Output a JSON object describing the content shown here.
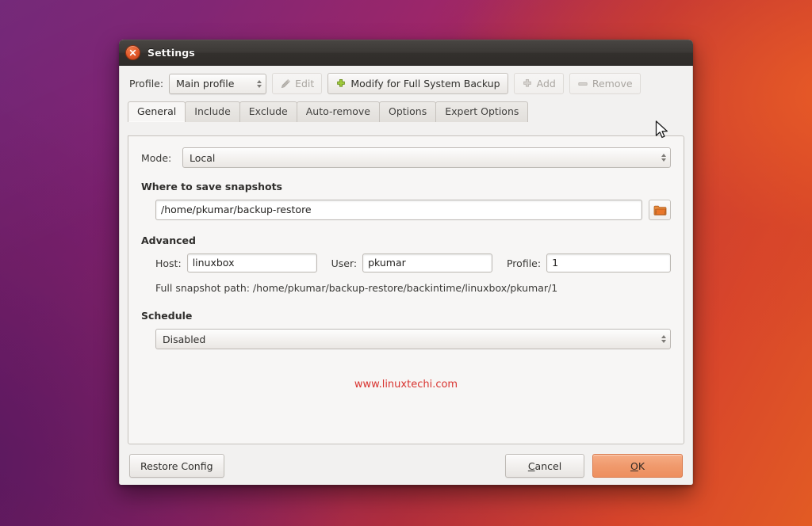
{
  "window": {
    "title": "Settings",
    "close_icon": "close-icon"
  },
  "toolbar": {
    "profile_label": "Profile:",
    "profile_value": "Main profile",
    "edit_label": "Edit",
    "edit_icon": "pencil-icon",
    "modify_label": "Modify for Full System Backup",
    "modify_icon": "plus-icon",
    "add_label": "Add",
    "add_icon": "plus-icon",
    "remove_label": "Remove",
    "remove_icon": "minus-icon"
  },
  "tabs": [
    {
      "label": "General",
      "active": true
    },
    {
      "label": "Include",
      "active": false
    },
    {
      "label": "Exclude",
      "active": false
    },
    {
      "label": "Auto-remove",
      "active": false
    },
    {
      "label": "Options",
      "active": false
    },
    {
      "label": "Expert Options",
      "active": false
    }
  ],
  "general": {
    "mode_label": "Mode:",
    "mode_value": "Local",
    "snapshots_heading": "Where to save snapshots",
    "snapshots_path": "/home/pkumar/backup-restore",
    "browse_icon": "folder-icon",
    "advanced_heading": "Advanced",
    "host_label": "Host:",
    "host_value": "linuxbox",
    "user_label": "User:",
    "user_value": "pkumar",
    "profile_label": "Profile:",
    "profile_value": "1",
    "full_path_text": "Full snapshot path: /home/pkumar/backup-restore/backintime/linuxbox/pkumar/1",
    "schedule_heading": "Schedule",
    "schedule_value": "Disabled"
  },
  "watermark": "www.linuxtechi.com",
  "footer": {
    "restore_label": "Restore Config",
    "cancel_mnemonic": "C",
    "cancel_rest": "ancel",
    "ok_mnemonic": "O",
    "ok_rest": "K"
  },
  "colors": {
    "accent_ok": "#f09a6d",
    "watermark": "#d8332f",
    "titlebar": "#3c3936",
    "close_button": "#e2582a",
    "folder_icon": "#e0762f"
  }
}
